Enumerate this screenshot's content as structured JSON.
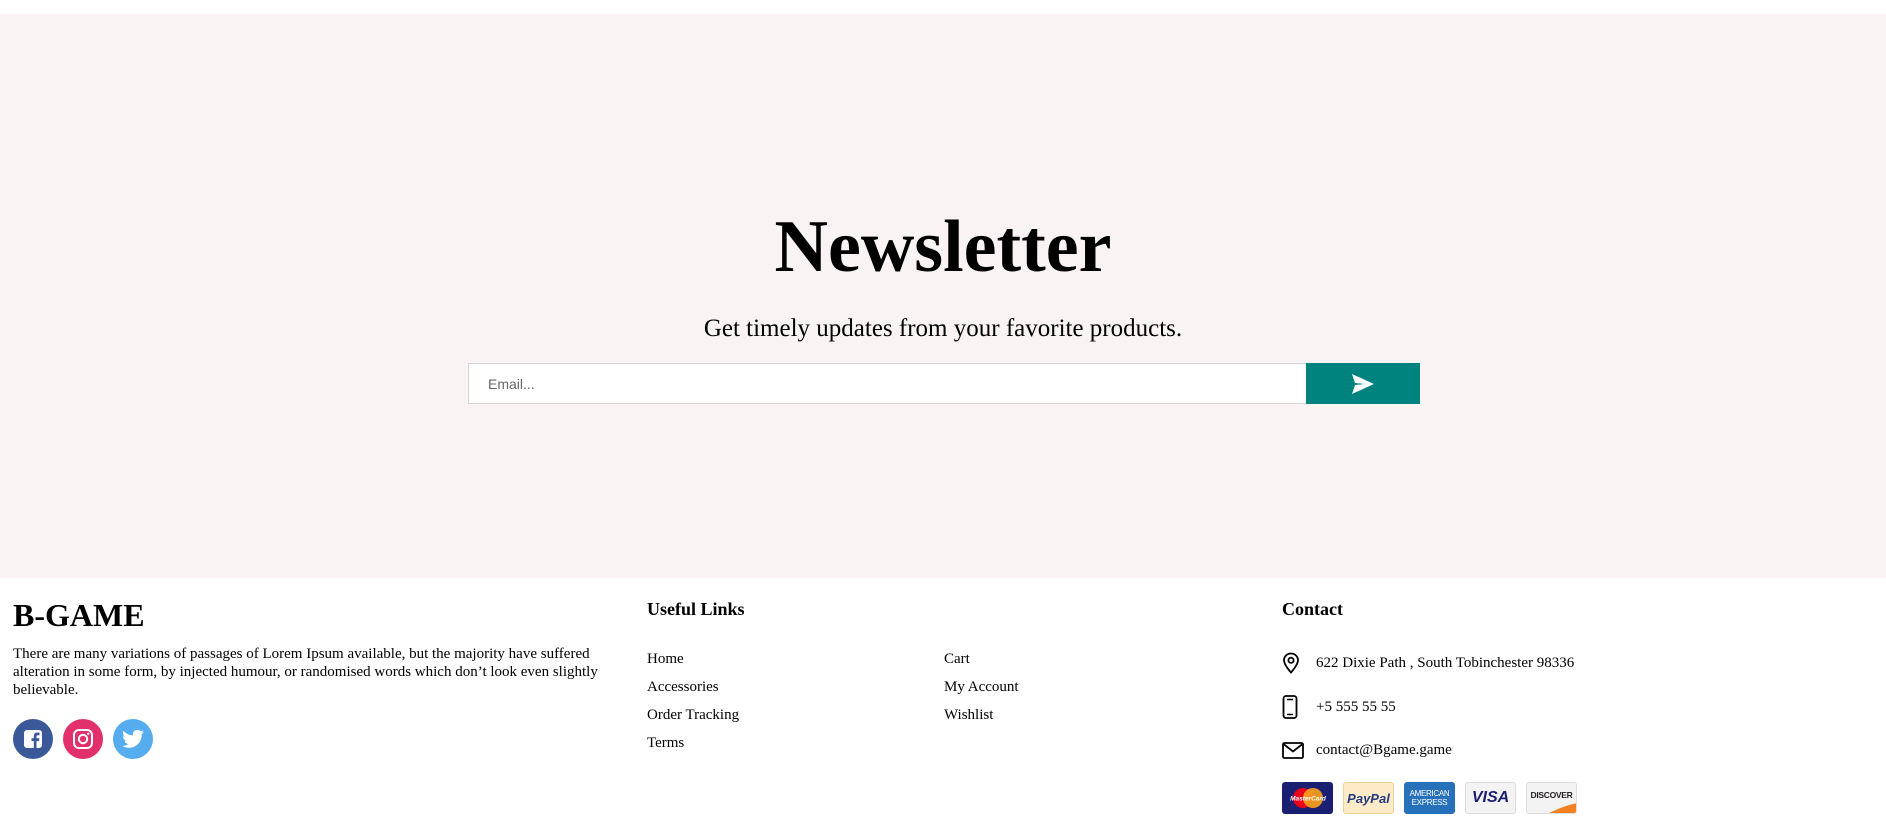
{
  "newsletter": {
    "title": "Newsletter",
    "subtitle": "Get timely updates from your favorite products.",
    "email_placeholder": "Email...",
    "accent_color": "#00827f",
    "background_color": "#f9f3f3"
  },
  "footer": {
    "brand": "B-GAME",
    "about": "There are many variations of passages of Lorem Ipsum available, but the majority have suffered alteration in some form, by injected humour, or randomised words which don’t look even slightly believable.",
    "social": [
      {
        "name": "facebook",
        "icon": "facebook-icon",
        "color": "#3b5998"
      },
      {
        "name": "instagram",
        "icon": "instagram-icon",
        "color": "#e1306c"
      },
      {
        "name": "twitter",
        "icon": "twitter-icon",
        "color": "#55acee"
      }
    ],
    "useful_links": {
      "heading": "Useful Links",
      "col1": [
        "Home",
        "Accessories",
        "Order Tracking",
        "Terms"
      ],
      "col2": [
        "Cart",
        "My Account",
        "Wishlist"
      ]
    },
    "contact": {
      "heading": "Contact",
      "address": "622 Dixie Path , South Tobinchester 98336",
      "phone": "+5 555 55 55",
      "email": "contact@Bgame.game"
    },
    "payments": [
      {
        "name": "mastercard",
        "label": "MasterCard"
      },
      {
        "name": "paypal",
        "label": "PayPal"
      },
      {
        "name": "american-express",
        "label": "AMERICAN EXPRESS"
      },
      {
        "name": "visa",
        "label": "VISA"
      },
      {
        "name": "discover",
        "label": "DISCOVER"
      }
    ]
  }
}
